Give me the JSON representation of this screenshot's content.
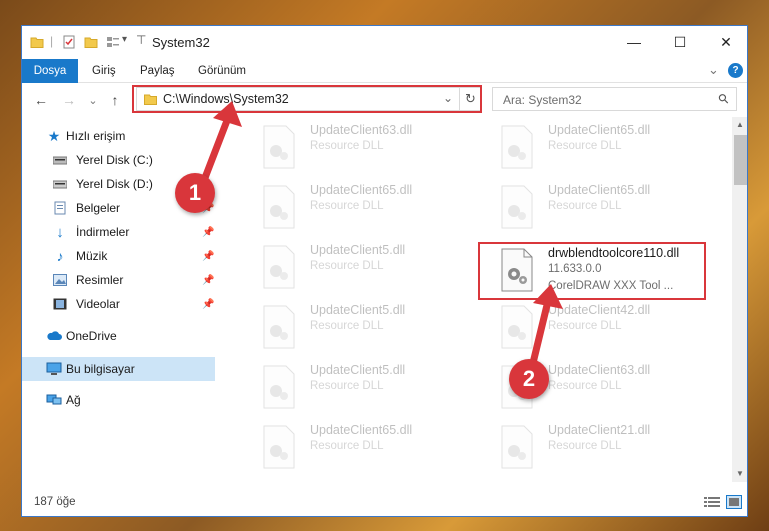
{
  "window": {
    "title": "System32",
    "minimize_glyph": "—",
    "maximize_glyph": "☐",
    "close_glyph": "✕"
  },
  "ribbon": {
    "tabs": [
      "Dosya",
      "Giriş",
      "Paylaş",
      "Görünüm"
    ],
    "help_glyph": "?",
    "collapse_glyph": "⌄"
  },
  "nav": {
    "back_glyph": "←",
    "forward_glyph": "→",
    "recent_glyph": "⌄",
    "up_glyph": "↑",
    "address": "C:\\Windows\\System32",
    "address_dropdown_glyph": "⌄",
    "refresh_glyph": "↻",
    "search_placeholder": "Ara: System32",
    "search_glyph": "⚲"
  },
  "sidebar": {
    "items": [
      {
        "label": "Hızlı erişim",
        "icon": "star-icon",
        "pinned": false
      },
      {
        "label": "Yerel Disk (C:)",
        "icon": "drive-icon",
        "pinned": false
      },
      {
        "label": "Yerel Disk (D:)",
        "icon": "drive-icon",
        "pinned": false
      },
      {
        "label": "Belgeler",
        "icon": "documents-icon",
        "pinned": true
      },
      {
        "label": "İndirmeler",
        "icon": "downloads-icon",
        "pinned": true
      },
      {
        "label": "Müzik",
        "icon": "music-icon",
        "pinned": true
      },
      {
        "label": "Resimler",
        "icon": "pictures-icon",
        "pinned": true
      },
      {
        "label": "Videolar",
        "icon": "videos-icon",
        "pinned": true
      },
      {
        "label": "OneDrive",
        "icon": "cloud-icon",
        "pinned": false
      },
      {
        "label": "Bu bilgisayar",
        "icon": "computer-icon",
        "pinned": false
      },
      {
        "label": "Ağ",
        "icon": "network-icon",
        "pinned": false
      }
    ]
  },
  "files": {
    "col1": [
      {
        "name": "UpdateClient63.dll",
        "type": "Resource DLL"
      },
      {
        "name": "UpdateClient65.dll",
        "type": "Resource DLL"
      },
      {
        "name": "UpdateClient5.dll",
        "type": "Resource DLL"
      },
      {
        "name": "UpdateClient5.dll",
        "type": "Resource DLL"
      },
      {
        "name": "UpdateClient5.dll",
        "type": "Resource DLL"
      },
      {
        "name": "UpdateClient65.dll",
        "type": "Resource DLL"
      }
    ],
    "col2": [
      {
        "name": "UpdateClient65.dll",
        "type": "Resource DLL"
      },
      {
        "name": "UpdateClient65.dll",
        "type": "Resource DLL"
      },
      {
        "name": "UpdateClient42.dll",
        "type": "Resource DLL"
      },
      {
        "name": "UpdateClient63.dll",
        "type": "Resource DLL"
      },
      {
        "name": "UpdateClient21.dll",
        "type": "Resource DLL"
      }
    ],
    "highlighted": {
      "name": "drwblendtoolcore110.dll",
      "version": "11.633.0.0",
      "description": "CorelDRAW XXX Tool ..."
    }
  },
  "status": {
    "count": "187 öğe"
  },
  "annotations": {
    "step1": "1",
    "step2": "2",
    "color": "#d9363b"
  }
}
